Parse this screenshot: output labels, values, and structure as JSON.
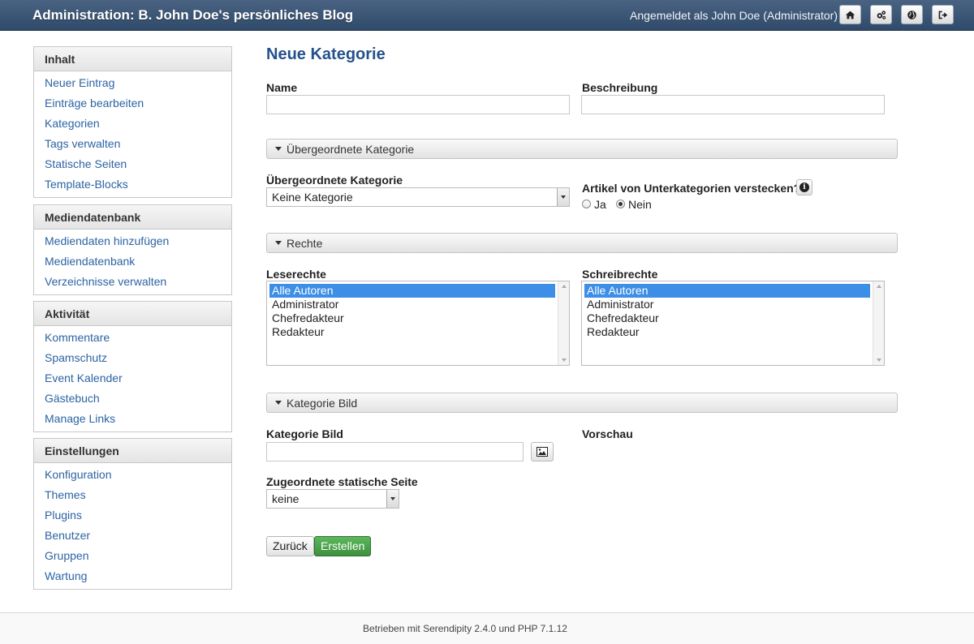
{
  "header": {
    "title": "Administration: B. John Doe's persönliches Blog",
    "user": "Angemeldet als John Doe (Administrator)",
    "buttons": [
      "home-icon",
      "cogs-icon",
      "globe-icon",
      "logout-icon"
    ]
  },
  "sidebar": {
    "inhalt": {
      "title": "Inhalt",
      "items": [
        "Neuer Eintrag",
        "Einträge bearbeiten",
        "Kategorien",
        "Tags verwalten",
        "Statische Seiten",
        "Template-Blocks"
      ]
    },
    "medien": {
      "title": "Mediendatenbank",
      "items": [
        "Mediendaten hinzufügen",
        "Mediendatenbank",
        "Verzeichnisse verwalten"
      ]
    },
    "aktivitaet": {
      "title": "Aktivität",
      "items": [
        "Kommentare",
        "Spamschutz",
        "Event Kalender",
        "Gästebuch",
        "Manage Links"
      ]
    },
    "einstellungen": {
      "title": "Einstellungen",
      "items": [
        "Konfiguration",
        "Themes",
        "Plugins",
        "Benutzer",
        "Gruppen",
        "Wartung"
      ]
    }
  },
  "main": {
    "heading": "Neue Kategorie",
    "name_label": "Name",
    "name_value": "",
    "beschreibung_label": "Beschreibung",
    "beschreibung_value": "",
    "section_parent": "Übergeordnete Kategorie",
    "parent_label": "Übergeordnete Kategorie",
    "parent_value": "Keine Kategorie",
    "hide_label": "Artikel von Unterkategorien verstecken?",
    "radio_ja": "Ja",
    "radio_nein": "Nein",
    "hide_selected": "Nein",
    "section_rights": "Rechte",
    "read_label": "Leserechte",
    "write_label": "Schreibrechte",
    "read_options": [
      "Alle Autoren",
      "Administrator",
      "Chefredakteur",
      "Redakteur"
    ],
    "write_options": [
      "Alle Autoren",
      "Administrator",
      "Chefredakteur",
      "Redakteur"
    ],
    "read_selected": "Alle Autoren",
    "write_selected": "Alle Autoren",
    "section_image": "Kategorie Bild",
    "image_label": "Kategorie Bild",
    "image_value": "",
    "preview_label": "Vorschau",
    "static_label": "Zugeordnete statische Seite",
    "static_value": "keine",
    "back_button": "Zurück",
    "create_button": "Erstellen"
  },
  "footer": {
    "text": "Betrieben mit Serendipity 2.4.0 und PHP 7.1.12"
  },
  "colors": {
    "header_bg": "#3b5677",
    "link": "#2c63a3",
    "heading": "#24518c",
    "primary_button": "#4cae4c",
    "list_selection": "#3d8ee6"
  }
}
